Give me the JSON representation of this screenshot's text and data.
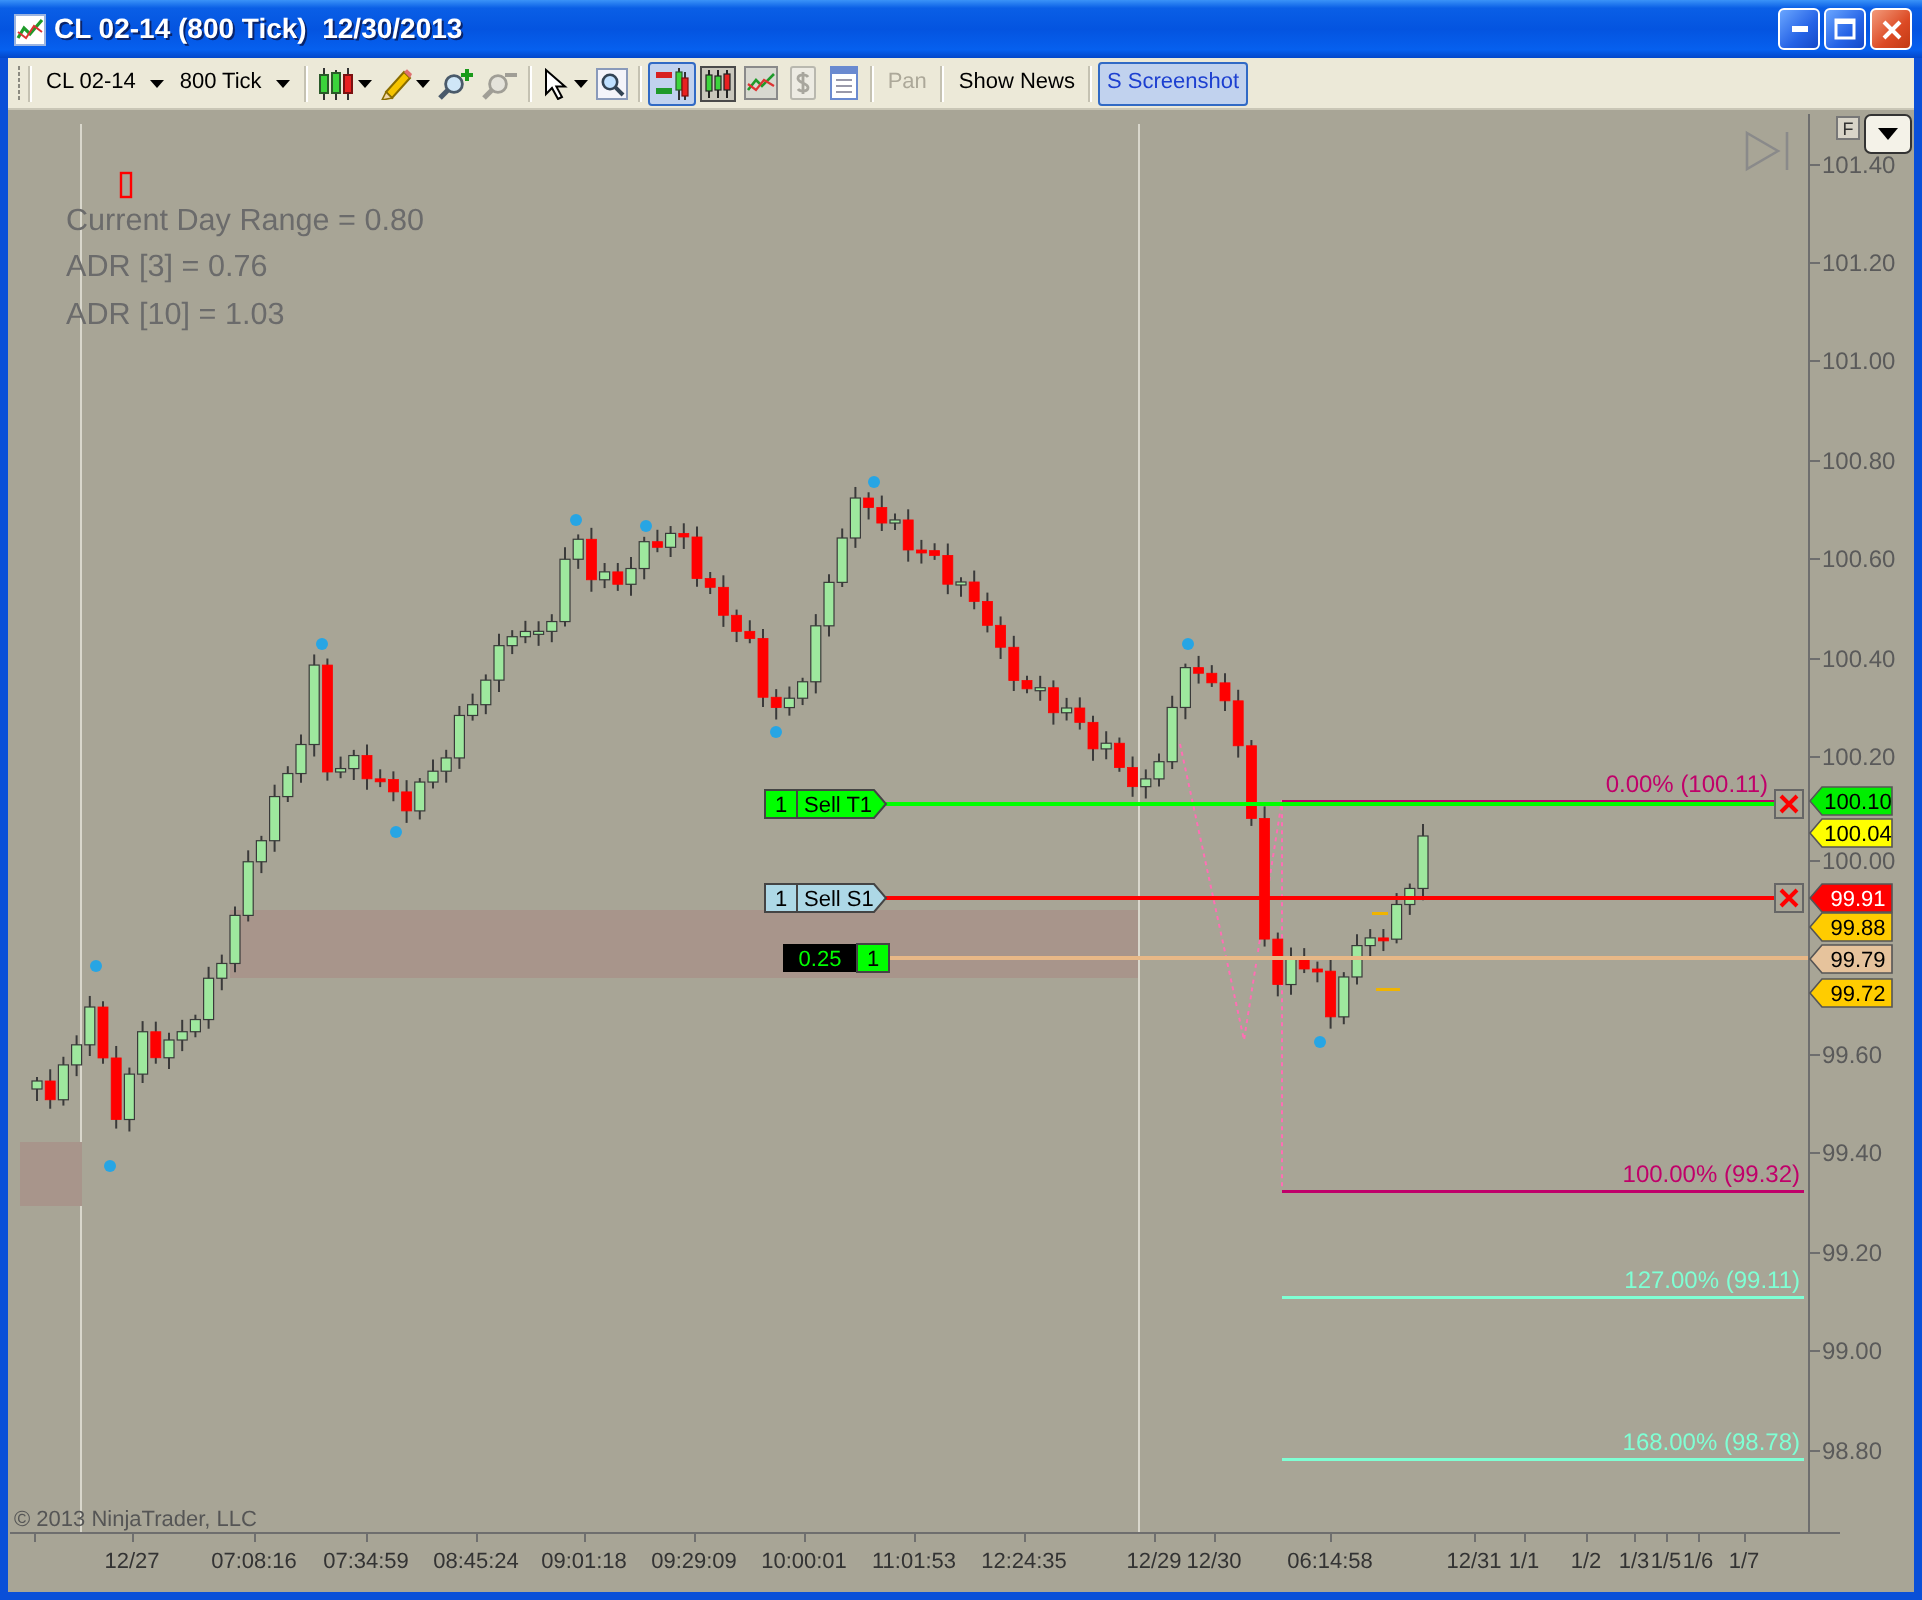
{
  "window": {
    "title": "CL 02-14 (800 Tick)  12/30/2013"
  },
  "toolbar": {
    "selectors": [
      {
        "label": "CL 02-14"
      },
      {
        "label": "800 Tick"
      }
    ],
    "tool_groups": [
      [
        {
          "menu": true,
          "disabled": false
        },
        {
          "menu": true,
          "disabled": false
        },
        {
          "menu": false,
          "disabled": false
        },
        {
          "menu": false,
          "disabled": true
        }
      ],
      [
        {
          "menu": true,
          "disabled": false
        },
        {
          "menu": false,
          "disabled": false
        }
      ],
      [
        {
          "pressed": true,
          "disabled": false
        },
        {
          "disabled": false
        },
        {
          "disabled": false
        },
        {
          "disabled": true
        },
        {
          "disabled": false
        }
      ]
    ],
    "text_buttons": [
      {
        "label": "Pan",
        "disabled": true,
        "pressed": false
      },
      {
        "label": "Show News",
        "disabled": false,
        "pressed": false
      },
      {
        "label": "S Screenshot",
        "disabled": false,
        "pressed": true
      }
    ]
  },
  "chart": {
    "scale_button": "F",
    "indicator_lines": [
      "Current Day Range = 0.80",
      "ADR [3] = 0.76",
      "ADR [10] = 1.03"
    ],
    "price_ticks": [
      "101.40",
      "101.20",
      "101.00",
      "100.80",
      "100.60",
      "100.40",
      "100.20",
      "100.00",
      "99.60",
      "99.40",
      "99.20",
      "99.00",
      "98.80"
    ],
    "orders": [
      {
        "kind": "target",
        "quantity": "1",
        "label": "Sell T1",
        "color": "#00ff00"
      },
      {
        "kind": "stop",
        "quantity": "1",
        "label": "Sell S1",
        "color": "#ff0000"
      },
      {
        "kind": "position",
        "quantity": "1",
        "label": "0.25",
        "color": "#e8b887"
      }
    ],
    "fib_levels": [
      {
        "label": "0.00% (100.11)",
        "color": "#c0006a"
      },
      {
        "label": "100.00% (99.32)",
        "color": "#c0006a"
      },
      {
        "label": "127.00% (99.11)",
        "color": "#7fffd4"
      },
      {
        "label": "168.00% (98.78)",
        "color": "#7fffd4"
      }
    ],
    "price_markers": [
      {
        "label": "100.10",
        "color": "#00ee00"
      },
      {
        "label": "100.04",
        "color": "#ffff00"
      },
      {
        "label": "99.91",
        "color": "#ff0000"
      },
      {
        "label": "99.88",
        "color": "#ffcc00"
      },
      {
        "label": "99.79",
        "color": "#e6c39c"
      },
      {
        "label": "99.72",
        "color": "#ffcc00"
      }
    ],
    "time_labels": [
      "12/27",
      "07:08:16",
      "07:34:59",
      "08:45:24",
      "09:01:18",
      "09:29:09",
      "10:00:01",
      "11:01:53",
      "12:24:35",
      "12/29",
      "12/30",
      "06:14:58",
      "12/31",
      "1/1",
      "1/2",
      "1/3",
      "1/5",
      "1/6",
      "1/7"
    ],
    "copyright": "© 2013 NinjaTrader, LLC"
  }
}
